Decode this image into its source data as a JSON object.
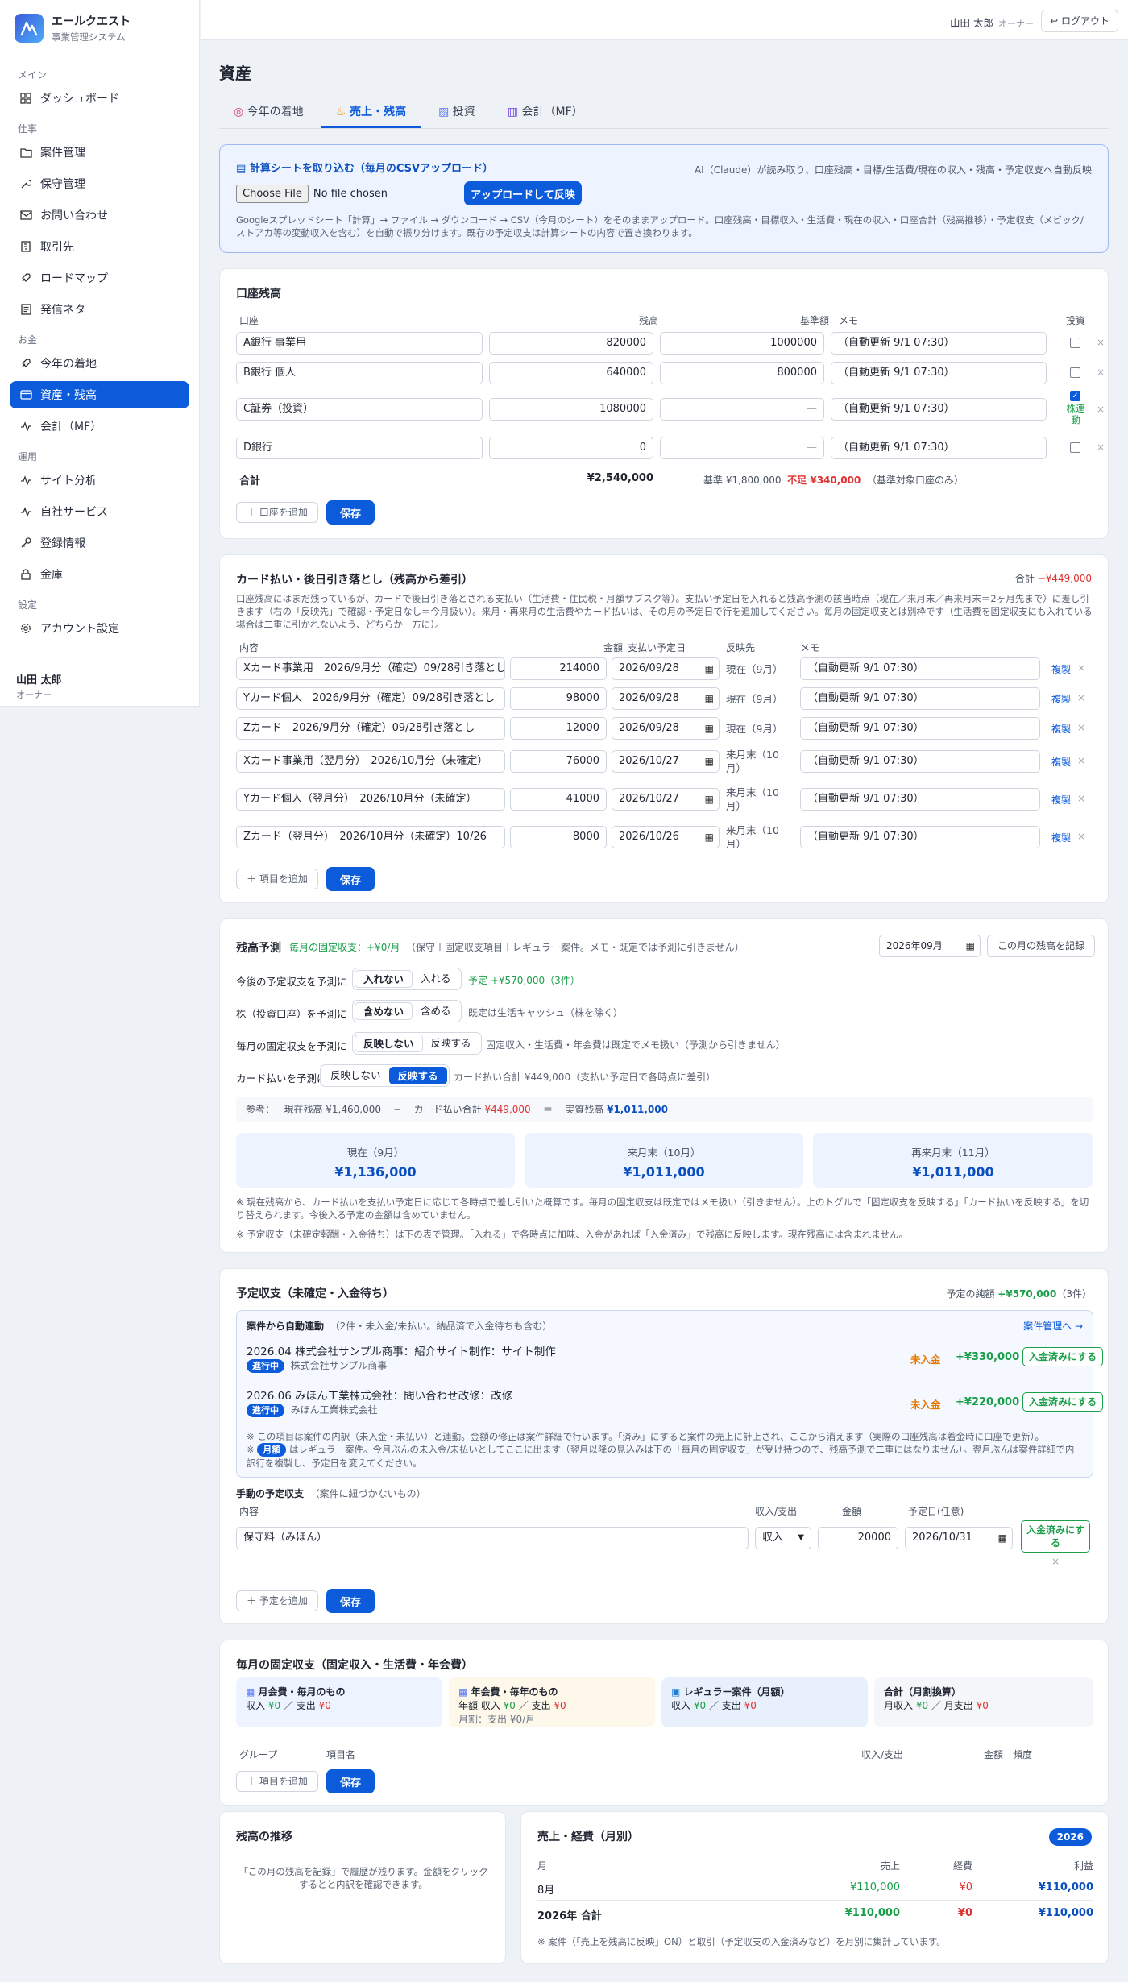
{
  "brand": {
    "name": "エールクエスト",
    "sub": "事業管理システム"
  },
  "sidebar": {
    "groups": [
      {
        "label": "メイン"
      },
      {
        "label": "仕事"
      },
      {
        "label": "お金"
      },
      {
        "label": "運用"
      },
      {
        "label": "設定"
      }
    ],
    "items": [
      {
        "label": "ダッシュボード",
        "icon": "dashboard-icon"
      },
      {
        "label": "案件管理",
        "icon": "folder-icon"
      },
      {
        "label": "保守管理",
        "icon": "wrench-icon"
      },
      {
        "label": "お問い合わせ",
        "icon": "mail-icon"
      },
      {
        "label": "取引先",
        "icon": "building-icon"
      },
      {
        "label": "ロードマップ",
        "icon": "rocket-icon"
      },
      {
        "label": "発信ネタ",
        "icon": "note-icon"
      },
      {
        "label": "今年の着地",
        "icon": "rocket-icon"
      },
      {
        "label": "資産・残高",
        "icon": "card-icon"
      },
      {
        "label": "会計（MF）",
        "icon": "pulse-icon"
      },
      {
        "label": "サイト分析",
        "icon": "pulse-icon"
      },
      {
        "label": "自社サービス",
        "icon": "pulse-icon"
      },
      {
        "label": "登録情報",
        "icon": "key-icon"
      },
      {
        "label": "金庫",
        "icon": "lock-icon"
      },
      {
        "label": "アカウント設定",
        "icon": "gear-icon"
      }
    ],
    "user": {
      "name": "山田 太郎",
      "role": "オーナー"
    }
  },
  "topbar": {
    "user": "山田 太郎",
    "role": "オーナー",
    "logout": "ログアウト"
  },
  "page": {
    "title": "資産"
  },
  "tabs": [
    "今年の着地",
    "売上・残高",
    "投資",
    "会計（MF）"
  ],
  "upload": {
    "title": "計算シートを取り込む（毎月のCSVアップロード）",
    "ai_note": "AI（Claude）が読み取り、口座残高・目標/生活費/現在の収入・残高・予定収支へ自動反映",
    "choose_file": "Choose File",
    "no_file": "No file chosen",
    "button": "アップロードして反映",
    "help": "Googleスプレッドシート「計算」→ ファイル → ダウンロード → CSV（今月のシート）をそのままアップロード。口座残高・目標収入・生活費・現在の収入・口座合計（残高推移）・予定収支（メビック/ストアカ等の変動収入を含む）を自動で振り分けます。既存の予定収支は計算シートの内容で置き換わります。"
  },
  "accounts": {
    "title": "口座残高",
    "headers": {
      "name": "口座",
      "balance": "残高",
      "base": "基準額",
      "memo": "メモ",
      "invest": "投資"
    },
    "rows": [
      {
        "name": "A銀行 事業用",
        "balance": "820000",
        "base": "1000000",
        "memo": "（自動更新 9/1 07:30）",
        "invest": false
      },
      {
        "name": "B銀行 個人",
        "balance": "640000",
        "base": "800000",
        "memo": "（自動更新 9/1 07:30）",
        "invest": false
      },
      {
        "name": "C証券（投資）",
        "balance": "1080000",
        "base": "—",
        "memo": "（自動更新 9/1 07:30）",
        "invest": true,
        "invest_label": "株連動"
      },
      {
        "name": "D銀行",
        "balance": "0",
        "base": "—",
        "memo": "（自動更新 9/1 07:30）",
        "invest": false
      }
    ],
    "total_label": "合計",
    "total": "¥2,540,000",
    "summary_base": "基準 ¥1,800,000",
    "summary_short": "不足 ¥340,000",
    "summary_note": "（基準対象口座のみ）",
    "add": "＋ 口座を追加",
    "save": "保存"
  },
  "cards": {
    "title": "カード払い・後日引き落とし（残高から差引）",
    "total_label": "合計",
    "total": "−¥449,000",
    "desc": "口座残高にはまだ残っているが、カードで後日引き落とされる支払い（生活費・住民税・月額サブスク等）。支払い予定日を入れると残高予測の該当時点（現在／来月末／再来月末＝2ヶ月先まで）に差し引きます（右の「反映先」で確認・予定日なし＝今月扱い）。来月・再来月の生活費やカード払いは、その月の予定日で行を追加してください。毎月の固定収支とは別枠です（生活費を固定収支にも入れている場合は二重に引かれないよう、どちらか一方に）。",
    "headers": {
      "content": "内容",
      "amount": "金額",
      "due": "支払い予定日",
      "target": "反映先",
      "memo": "メモ"
    },
    "rows": [
      {
        "content": "Xカード事業用　2026/9月分（確定）09/28引き落とし",
        "amount": "214000",
        "due": "2026/09/28",
        "target": "現在（9月）",
        "memo": "（自動更新 9/1 07:30）"
      },
      {
        "content": "Yカード個人　2026/9月分（確定）09/28引き落とし",
        "amount": "98000",
        "due": "2026/09/28",
        "target": "現在（9月）",
        "memo": "（自動更新 9/1 07:30）"
      },
      {
        "content": "Zカード　2026/9月分（確定）09/28引き落とし",
        "amount": "12000",
        "due": "2026/09/28",
        "target": "現在（9月）",
        "memo": "（自動更新 9/1 07:30）"
      },
      {
        "content": "Xカード事業用（翌月分）　2026/10月分（未確定）",
        "amount": "76000",
        "due": "2026/10/27",
        "target": "来月末（10月）",
        "memo": "（自動更新 9/1 07:30）"
      },
      {
        "content": "Yカード個人（翌月分）　2026/10月分（未確定）",
        "amount": "41000",
        "due": "2026/10/27",
        "target": "来月末（10月）",
        "memo": "（自動更新 9/1 07:30）"
      },
      {
        "content": "Zカード（翌月分）　2026/10月分（未確定）10/26",
        "amount": "8000",
        "due": "2026/10/26",
        "target": "来月末（10月）",
        "memo": "（自動更新 9/1 07:30）"
      }
    ],
    "copy": "複製",
    "add": "＋ 項目を追加",
    "save": "保存"
  },
  "forecast": {
    "title": "残高予測",
    "fixed": "毎月の固定収支：+¥0/月",
    "fixed_note": "（保守＋固定収支項目＋レギュラー案件。メモ・既定では予測に引きません）",
    "month": "2026年09月",
    "record": "この月の残高を記録",
    "rows": [
      {
        "label": "今後の予定収支を予測に",
        "opt1": "入れない",
        "opt2": "入れる",
        "note": "予定 +¥570,000（3件）"
      },
      {
        "label": "株（投資口座）を予測に",
        "opt1": "含めない",
        "opt2": "含める",
        "note": "既定は生活キャッシュ（株を除く）"
      },
      {
        "label": "毎月の固定収支を予測に",
        "opt1": "反映しない",
        "opt2": "反映する",
        "note": "固定収入・生活費・年会費は既定でメモ扱い（予測から引きません）"
      },
      {
        "label": "カード払いを予測に",
        "opt1": "反映しない",
        "opt2": "反映する",
        "note": "カード払い合計 ¥449,000（支払い予定日で各時点に差引）"
      }
    ],
    "ref": {
      "label": "参考：",
      "current": "現在残高 ¥1,460,000",
      "minus": "−",
      "card_label": "カード払い合計",
      "card": "¥449,000",
      "eq": "＝",
      "real_label": "実質残高",
      "real": "¥1,011,000"
    },
    "boxes": [
      {
        "label": "現在（9月）",
        "value": "¥1,136,000"
      },
      {
        "label": "来月末（10月）",
        "value": "¥1,011,000"
      },
      {
        "label": "再来月末（11月）",
        "value": "¥1,011,000"
      }
    ],
    "note1": "※ 現在残高から、カード払いを支払い予定日に応じて各時点で差し引いた概算です。毎月の固定収支は既定ではメモ扱い（引きません）。上のトグルで「固定収支を反映する」「カード払いを反映する」を切り替えられます。今後入る予定の金額は含めていません。",
    "note2": "※ 予定収支（未確定報酬・入金待ち）は下の表で管理。「入れる」で各時点に加味、入金があれば「入金済み」で残高に反映します。現在残高には含まれません。"
  },
  "planned": {
    "title": "予定収支（未確定・入金待ち）",
    "total_label": "予定の純額",
    "total": "+¥570,000",
    "total_count": "（3件）",
    "auto_title": "案件から自動連動",
    "auto_sub": "（2件・未入金/未払い。納品済で入金待ちも含む）",
    "auto_link": "案件管理へ →",
    "items": [
      {
        "title": "2026.04 株式会社サンプル商事：紹介サイト制作：サイト制作",
        "status": "進行中",
        "client": "株式会社サンプル商事",
        "state": "未入金",
        "amount": "+¥330,000",
        "button": "入金済みにする"
      },
      {
        "title": "2026.06 みほん工業株式会社：問い合わせ改修：改修",
        "status": "進行中",
        "client": "みほん工業株式会社",
        "state": "未入金",
        "amount": "+¥220,000",
        "button": "入金済みにする"
      }
    ],
    "auto_note1": "※ この項目は案件の内訳（未入金・未払い）と連動。金額の修正は案件詳細で行います。「済み」にすると案件の売上に計上され、ここから消えます（実際の口座残高は着金時に口座で更新）。",
    "auto_note2_pre": "※",
    "auto_note2_pill": "月額",
    "auto_note2": "はレギュラー案件。今月ぶんの未入金/未払いとしてここに出ます（翌月以降の見込みは下の「毎月の固定収支」が受け持つので、残高予測で二重にはなりません）。翌月ぶんは案件詳細で内訳行を複製し、予定日を変えてください。",
    "manual_title": "手動の予定収支",
    "manual_sub": "（案件に紐づかないもの）",
    "headers": {
      "content": "内容",
      "type": "収入/支出",
      "amount": "金額",
      "date": "予定日(任意)"
    },
    "manual_rows": [
      {
        "content": "保守料（みほん）",
        "type": "収入",
        "amount": "20000",
        "date": "2026/10/31",
        "button": "入金済みにする"
      }
    ],
    "add": "＋ 予定を追加",
    "save": "保存"
  },
  "fixed": {
    "title": "毎月の固定収支（固定収入・生活費・年会費）",
    "boxes": [
      {
        "title": "月会費・毎月のもの",
        "line1_a": "収入",
        "in": "¥0",
        "line1_b": "／ 支出",
        "out": "¥0",
        "line2": ""
      },
      {
        "title": "年会費・毎年のもの",
        "line1_a": "年額 収入",
        "in": "¥0",
        "line1_b": "／ 支出",
        "out": "¥0",
        "line2": "月割：支出 ¥0/月"
      },
      {
        "title": "レギュラー案件（月額）",
        "line1_a": "収入",
        "in": "¥0",
        "line1_b": "／ 支出",
        "out": "¥0",
        "line2": ""
      },
      {
        "title": "合計（月割換算）",
        "line1_a": "月収入",
        "in": "¥0",
        "line1_b": "／ 月支出",
        "out": "¥0",
        "line2": ""
      }
    ],
    "headers": {
      "group": "グループ",
      "name": "項目名",
      "type": "収入/支出",
      "amount": "金額",
      "freq": "頻度"
    },
    "add": "＋ 項目を追加",
    "save": "保存"
  },
  "trend": {
    "title": "残高の推移",
    "empty": "「この月の残高を記録」で履歴が残ります。金額をクリックするとと内訳を確認できます。"
  },
  "monthly": {
    "title": "売上・経費（月別）",
    "year": "2026",
    "headers": {
      "month": "月",
      "sales": "売上",
      "cost": "経費",
      "profit": "利益"
    },
    "rows": [
      {
        "month": "8月",
        "sales": "¥110,000",
        "cost": "¥0",
        "profit": "¥110,000"
      }
    ],
    "total": {
      "month": "2026年 合計",
      "sales": "¥110,000",
      "cost": "¥0",
      "profit": "¥110,000"
    },
    "note": "※ 案件（「売上を残高に反映」ON）と取引（予定収支の入金済みなど）を月別に集計しています。"
  },
  "colors": {
    "accent": "#0b5bdb",
    "positive": "#1a9e49",
    "negative": "#e03131",
    "pending": "#e67700"
  }
}
